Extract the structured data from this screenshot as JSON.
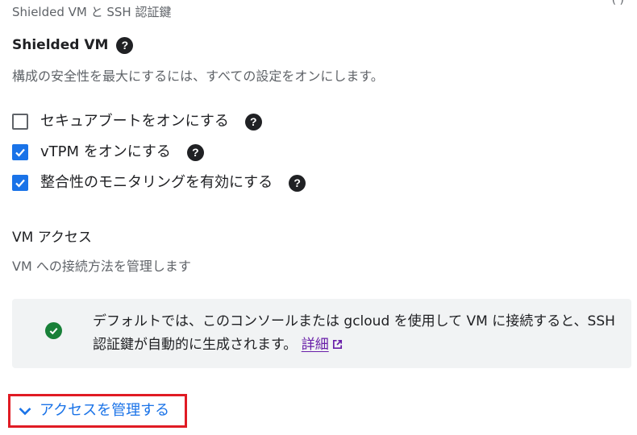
{
  "header": {
    "caption": "Shielded VM と SSH 認証鍵"
  },
  "shielded_vm": {
    "title": "Shielded VM",
    "description": "構成の安全性を最大にするには、すべての設定をオンにします。",
    "options": [
      {
        "label": "セキュアブートをオンにする",
        "checked": false
      },
      {
        "label": "vTPM をオンにする",
        "checked": true
      },
      {
        "label": "整合性のモニタリングを有効にする",
        "checked": true
      }
    ]
  },
  "vm_access": {
    "title": "VM アクセス",
    "description": "VM への接続方法を管理します",
    "info_text": "デフォルトでは、このコンソールまたは gcloud を使用して VM に接続すると、SSH 認証鍵が自動的に生成されます。",
    "info_link": "詳細",
    "manage_label": "アクセスを管理する"
  },
  "colors": {
    "accent": "#1a73e8",
    "success": "#188038",
    "link_visited": "#681da8",
    "highlight_border": "#e01b24"
  },
  "icons": {
    "help": "help-circle-icon",
    "success": "check-circle-icon",
    "external": "open-in-new-icon",
    "expand": "chevron-down-icon"
  }
}
